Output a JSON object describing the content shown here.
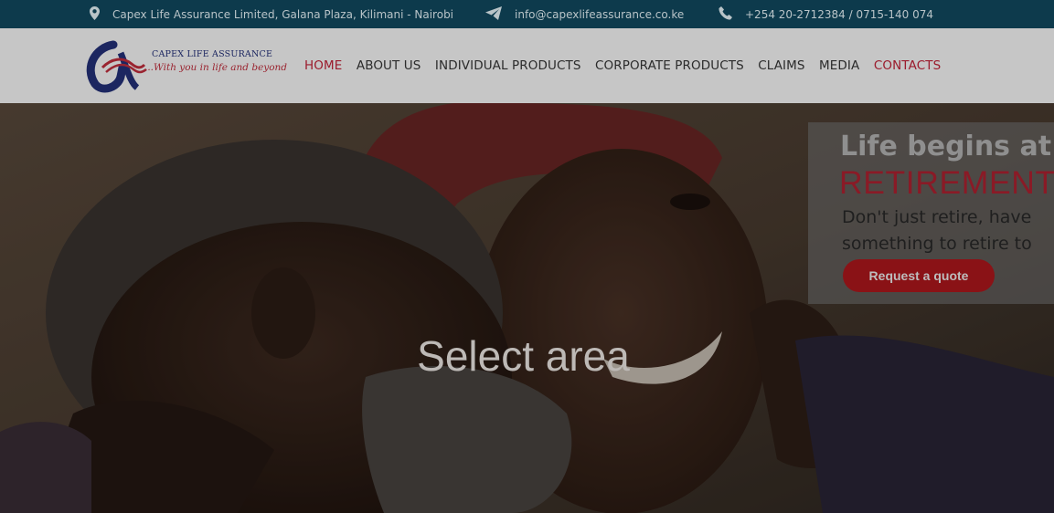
{
  "topbar": {
    "address": "Capex Life Assurance Limited, Galana Plaza, Kilimani - Nairobi",
    "email": "info@capexlifeassurance.co.ke",
    "phone": "+254 20-2712384 / 0715-140 074",
    "icons": [
      "map-pin-icon",
      "send-icon",
      "phone-icon"
    ]
  },
  "logo": {
    "line1": "CAPEX LIFE ASSURANCE",
    "line2": "...With you in life and beyond"
  },
  "nav": {
    "items": [
      "HOME",
      "ABOUT US",
      "INDIVIDUAL PRODUCTS",
      "CORPORATE PRODUCTS",
      "CLAIMS",
      "MEDIA",
      "CONTACTS"
    ],
    "active": "HOME"
  },
  "hero": {
    "overlay_text": "Select area"
  },
  "promo": {
    "line1": "Life begins at",
    "line2": "RETIREMENT",
    "tagline": "Don't just retire, have something to retire to",
    "button": "Request a quote"
  },
  "colors": {
    "topbar_bg": "#0d3a4c",
    "accent": "#9b1b2c",
    "nav_bg": "#c6c6c6"
  }
}
